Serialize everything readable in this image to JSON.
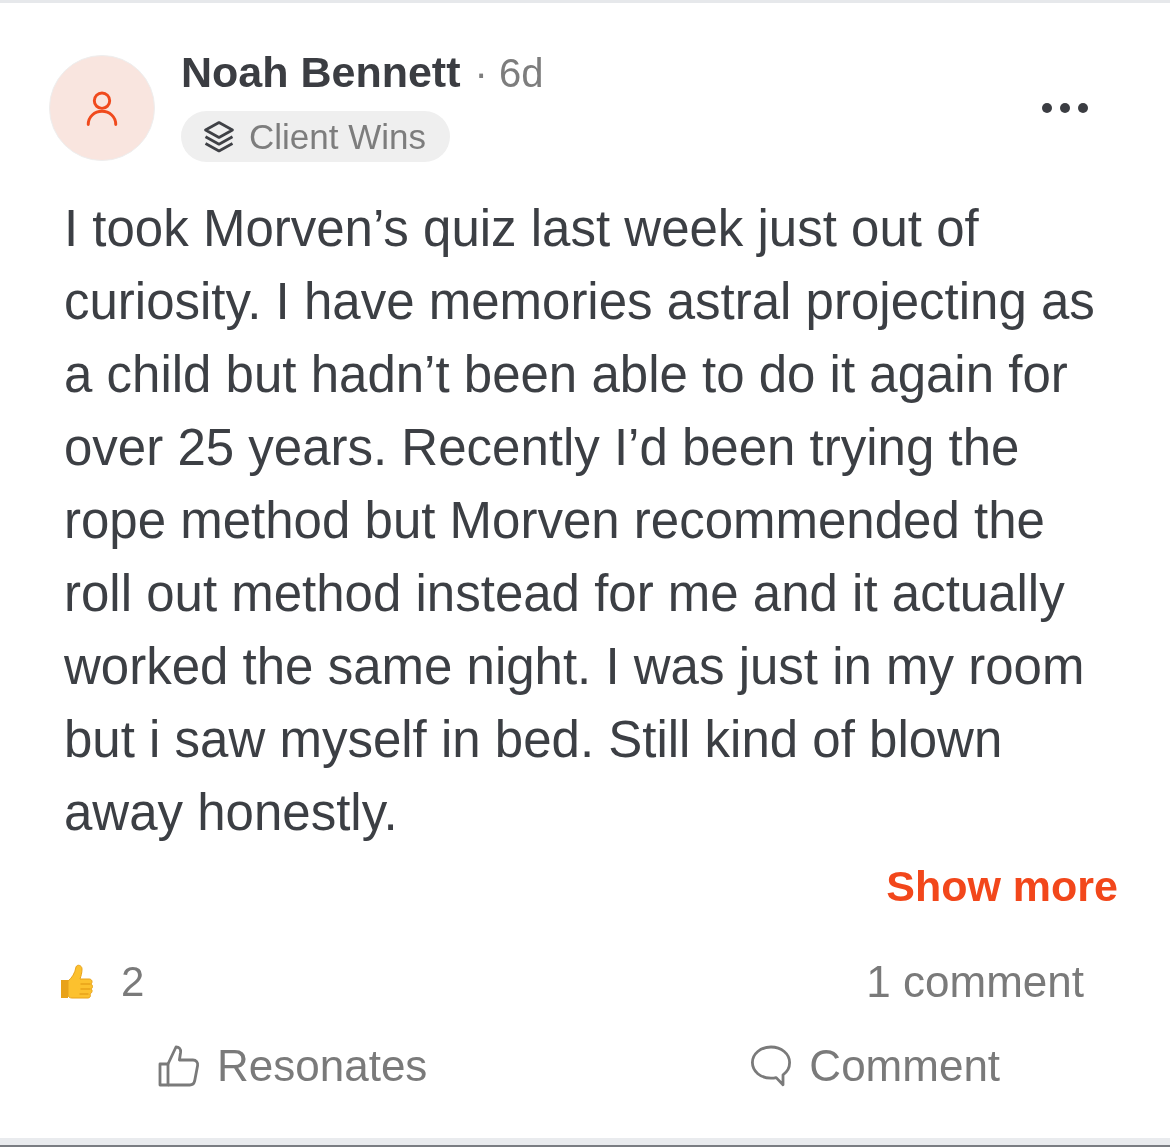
{
  "post": {
    "author": "Noah Bennett",
    "time": "· 6d",
    "group": "Client Wins",
    "body": "I took Morven’s quiz last week just out of curiosity. I have memories astral projecting as a child but hadn’t been able to do it again for over 25 years. Recently I’d been trying the rope method but Morven recommended the roll out method instead for me and it actually worked the same night. I was just in my room but i saw myself in bed. Still kind of blown away honestly.",
    "show_more": "Show more"
  },
  "stats": {
    "reactions": "2",
    "comments": "1 comment"
  },
  "actions": [
    {
      "kind": "like",
      "label": "Resonates"
    },
    {
      "kind": "comment",
      "label": "Comment"
    }
  ]
}
